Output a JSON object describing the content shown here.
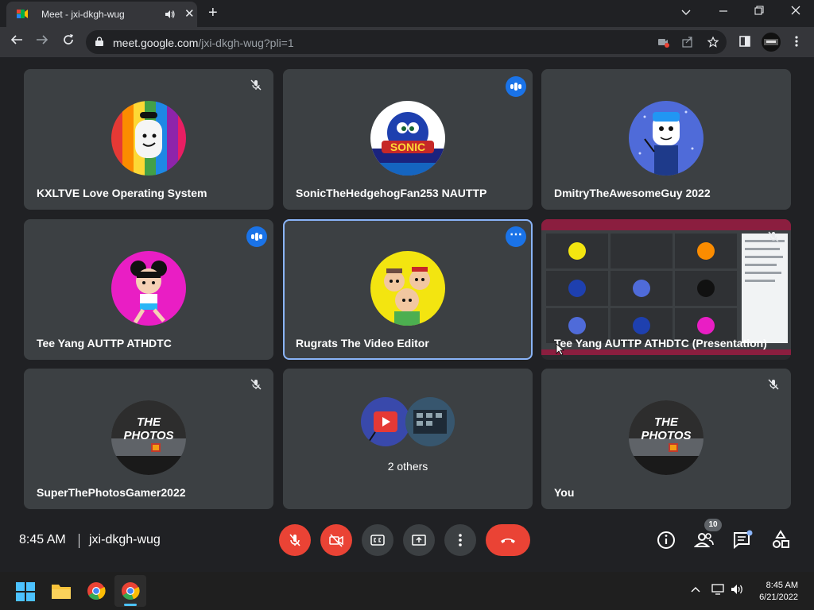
{
  "browser": {
    "tab_title": "Meet - jxi-dkgh-wug",
    "url_host": "meet.google.com",
    "url_path": "/jxi-dkgh-wug?pli=1"
  },
  "tiles": [
    {
      "name": "KXLTVE Love Operating System",
      "state": "muted"
    },
    {
      "name": "SonicTheHedgehogFan253 NAUTTP",
      "state": "talking"
    },
    {
      "name": "DmitryTheAwesomeGuy 2022",
      "state": "none"
    },
    {
      "name": "Tee Yang AUTTP ATHDTC",
      "state": "talking"
    },
    {
      "name": "Rugrats The Video Editor",
      "state": "more"
    },
    {
      "name": "Tee Yang AUTTP ATHDTC (Presentation)",
      "state": "muted"
    },
    {
      "name": "SuperThePhotosGamer2022",
      "state": "muted"
    },
    {
      "name": "2 others",
      "state": "none"
    },
    {
      "name": "You",
      "state": "muted"
    }
  ],
  "avatar_text": {
    "sonic_logo": "SONIC",
    "photos_line1": "THE",
    "photos_line2": "PHOTOS"
  },
  "meeting": {
    "time": "8:45 AM",
    "code": "jxi-dkgh-wug",
    "participant_count": "10"
  },
  "taskbar": {
    "time": "8:45 AM",
    "date": "6/21/2022"
  },
  "colors": {
    "background": "#202124",
    "tile": "#3c4043",
    "accent": "#1a73e8",
    "danger": "#ea4335"
  }
}
